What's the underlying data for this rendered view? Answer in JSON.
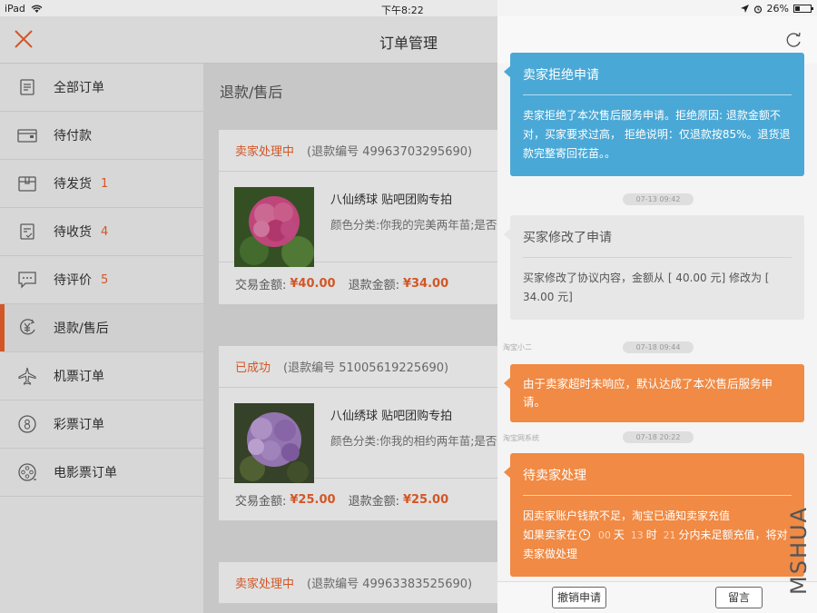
{
  "status_bar": {
    "device": "iPad",
    "time": "下午8:22",
    "battery": "26%",
    "battery_level": 0.26
  },
  "header": {
    "title": "订单管理"
  },
  "sidebar": {
    "items": [
      {
        "label": "全部订单",
        "badge": "",
        "icon": "list-icon"
      },
      {
        "label": "待付款",
        "badge": "",
        "icon": "wallet-icon"
      },
      {
        "label": "待发货",
        "badge": "1",
        "icon": "box-icon"
      },
      {
        "label": "待收货",
        "badge": "4",
        "icon": "clipboard-check-icon"
      },
      {
        "label": "待评价",
        "badge": "5",
        "icon": "comment-icon"
      },
      {
        "label": "退款/售后",
        "badge": "",
        "icon": "yen-refund-icon",
        "active": true
      },
      {
        "label": "机票订单",
        "badge": "",
        "icon": "airplane-icon"
      },
      {
        "label": "彩票订单",
        "badge": "",
        "icon": "lottery-icon"
      },
      {
        "label": "电影票订单",
        "badge": "",
        "icon": "film-reel-icon"
      }
    ]
  },
  "main": {
    "section_title": "退款/售后",
    "orders": [
      {
        "status": "卖家处理中",
        "refund_no": "(退款编号 49963703295690)",
        "name": "八仙绣球 贴吧团购专拍",
        "spec": "颜色分类:你我的完美两年苗;是否含",
        "trade_label": "交易金额:",
        "trade_amount": "¥40.00",
        "refund_label": "退款金额:",
        "refund_amount": "¥34.00",
        "color": "#d9508c"
      },
      {
        "status": "已成功",
        "refund_no": "(退款编号 51005619225690)",
        "name": "八仙绣球 贴吧团购专拍",
        "spec": "颜色分类:你我的相约两年苗;是否含",
        "trade_label": "交易金额:",
        "trade_amount": "¥25.00",
        "refund_label": "退款金额:",
        "refund_amount": "¥25.00",
        "color": "#a884c8"
      },
      {
        "status": "卖家处理中",
        "refund_no": "(退款编号 49963383525690)"
      }
    ]
  },
  "panel": {
    "messages": [
      {
        "title": "卖家拒绝申请",
        "body": "卖家拒绝了本次售后服务申请。拒绝原因: 退款金额不对，买家要求过高， 拒绝说明：仅退款按85%。退货退款完整寄回花苗。。"
      },
      {
        "time": "07-13 09:42",
        "title": "买家修改了申请",
        "body": "买家修改了协议内容，金额从 [ 40.00 元] 修改为 [ 34.00 元]"
      },
      {
        "sender": "淘宝小二",
        "time": "07-18 09:44",
        "body": "由于卖家超时未响应，默认达成了本次售后服务申请。"
      },
      {
        "sender": "淘宝网系统",
        "time": "07-18 20:22",
        "title": "待卖家处理",
        "body1": "因卖家账户钱款不足，淘宝已通知卖家充值",
        "body2_pre": "如果卖家在",
        "days": "00",
        "days_label": "天",
        "hours": "13",
        "hours_label": "时",
        "minutes": "21",
        "minutes_label": "分内未足额充值，将对卖家做处理"
      }
    ],
    "cancel_button": "撤销申请",
    "message_button": "留言"
  },
  "watermark": "MSHUA"
}
